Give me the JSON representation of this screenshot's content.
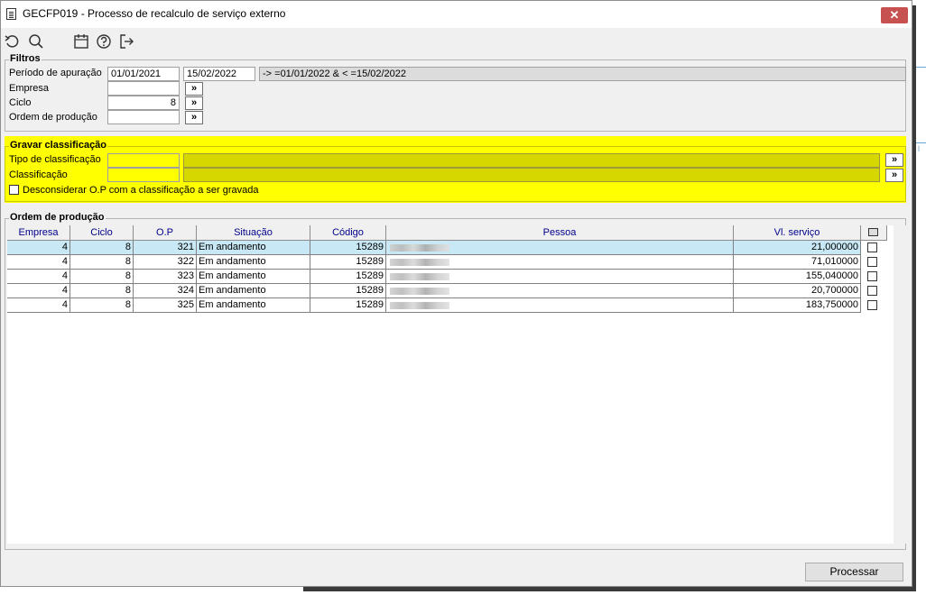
{
  "window": {
    "title": "GECFP019 - Processo de recalculo de serviço externo",
    "close_glyph": "✕"
  },
  "toolbar": {
    "icons": [
      "undo-icon",
      "search-icon",
      "calendar-icon",
      "help-icon",
      "exit-icon"
    ]
  },
  "filtros": {
    "title": "Filtros",
    "periodo_label": "Período de apuração",
    "periodo_inicio": "01/01/2021",
    "periodo_fim": "15/02/2022",
    "periodo_expr": "-> =01/01/2022 & < =15/02/2022",
    "empresa_label": "Empresa",
    "empresa_value": "",
    "ciclo_label": "Ciclo",
    "ciclo_value": "8",
    "ordem_label": "Ordem de produção",
    "ordem_value": "",
    "lookup_glyph": "»"
  },
  "gravar": {
    "title": "Gravar classificação",
    "tipo_label": "Tipo de classificação",
    "tipo_value": "",
    "tipo_desc": "",
    "classificacao_label": "Classificação",
    "classificacao_value": "",
    "classificacao_desc": "",
    "desconsiderar_label": "Desconsiderar O.P com a classificação a ser gravada",
    "desconsiderar_checked": false
  },
  "ordens": {
    "title": "Ordem de produção",
    "columns": [
      "Empresa",
      "Ciclo",
      "O.P",
      "Situação",
      "Código",
      "Pessoa",
      "Vl. serviço"
    ],
    "rows": [
      {
        "empresa": "4",
        "ciclo": "8",
        "op": "321",
        "situacao": "Em andamento",
        "codigo": "15289",
        "pessoa": "",
        "valor": "21,000000",
        "checked": false
      },
      {
        "empresa": "4",
        "ciclo": "8",
        "op": "322",
        "situacao": "Em andamento",
        "codigo": "15289",
        "pessoa": "",
        "valor": "71,010000",
        "checked": false
      },
      {
        "empresa": "4",
        "ciclo": "8",
        "op": "323",
        "situacao": "Em andamento",
        "codigo": "15289",
        "pessoa": "",
        "valor": "155,040000",
        "checked": false
      },
      {
        "empresa": "4",
        "ciclo": "8",
        "op": "324",
        "situacao": "Em andamento",
        "codigo": "15289",
        "pessoa": "",
        "valor": "20,700000",
        "checked": false
      },
      {
        "empresa": "4",
        "ciclo": "8",
        "op": "325",
        "situacao": "Em andamento",
        "codigo": "15289",
        "pessoa": "",
        "valor": "183,750000",
        "checked": false
      }
    ]
  },
  "footer": {
    "processar_label": "Processar"
  },
  "colors": {
    "highlight": "#ffff00",
    "selected_row": "#c7e8f4",
    "header_text": "#00008b",
    "close": "#c75050"
  }
}
